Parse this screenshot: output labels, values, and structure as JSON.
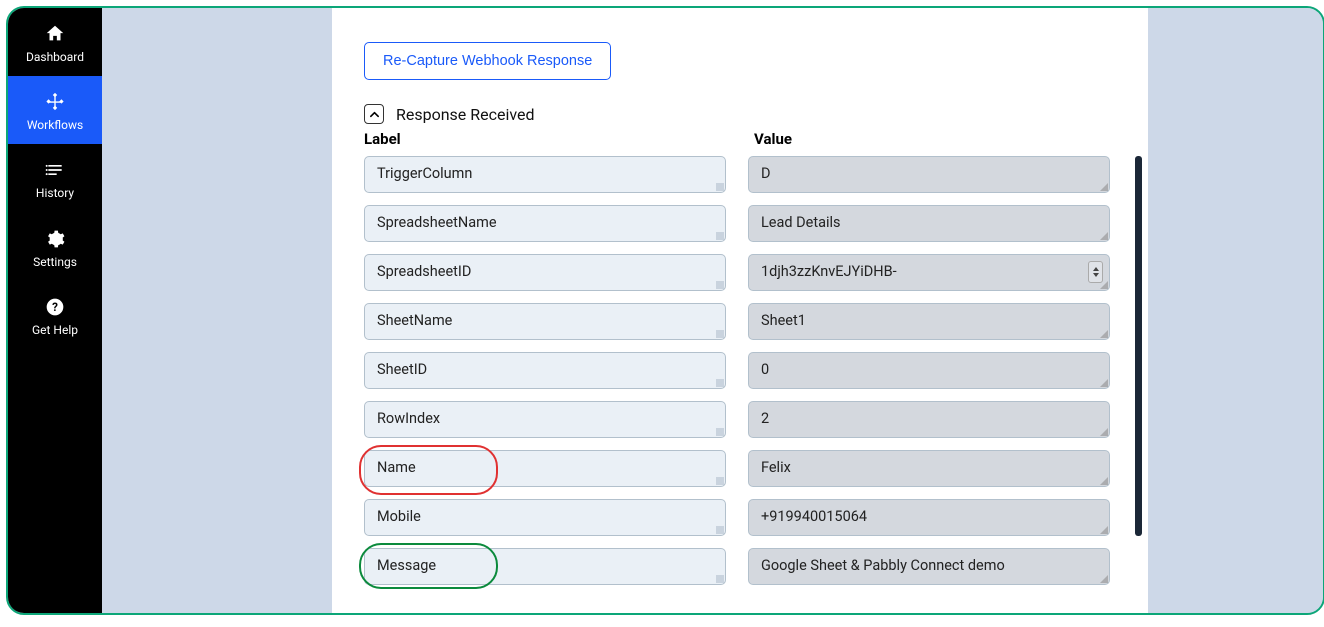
{
  "sidebar": {
    "items": [
      {
        "label": "Dashboard",
        "icon": "home"
      },
      {
        "label": "Workflows",
        "icon": "workflow"
      },
      {
        "label": "History",
        "icon": "history"
      },
      {
        "label": "Settings",
        "icon": "gear"
      },
      {
        "label": "Get Help",
        "icon": "help"
      }
    ],
    "activeIndex": 1
  },
  "main": {
    "recaptureButton": "Re-Capture Webhook Response",
    "responseReceived": "Response Received",
    "columns": {
      "label": "Label",
      "value": "Value"
    },
    "rows": [
      {
        "label": "TriggerColumn",
        "value": "D"
      },
      {
        "label": "SpreadsheetName",
        "value": "Lead Details"
      },
      {
        "label": "SpreadsheetID",
        "value": "1djh3zzKnvEJYiDHB-",
        "spinner": true
      },
      {
        "label": "SheetName",
        "value": "Sheet1"
      },
      {
        "label": "SheetID",
        "value": "0"
      },
      {
        "label": "RowIndex",
        "value": "2"
      },
      {
        "label": "Name",
        "value": "Felix",
        "highlight": "red"
      },
      {
        "label": "Mobile",
        "value": "+919940015064"
      },
      {
        "label": "Message",
        "value": "Google Sheet & Pabbly Connect demo",
        "highlight": "green"
      }
    ]
  }
}
